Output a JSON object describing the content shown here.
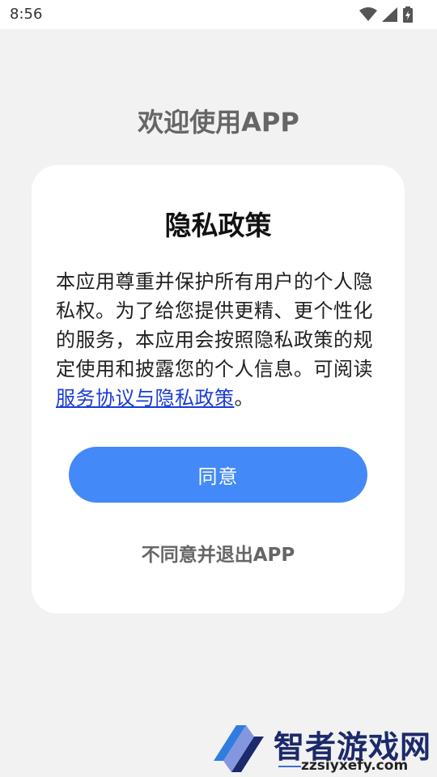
{
  "status_bar": {
    "time": "8:56",
    "icons": [
      "wifi-icon",
      "cellular-signal-icon",
      "battery-charging-icon"
    ]
  },
  "welcome_title": "欢迎使用APP",
  "dialog": {
    "title": "隐私政策",
    "body_text": "本应用尊重并保护所有用户的个人隐私权。为了给您提供更精、更个性化的服务，本应用会按照隐私政策的规定使用和披露您的个人信息。可阅读",
    "link_text": "服务协议与隐私政策",
    "body_end": "。",
    "agree_label": "同意",
    "disagree_label": "不同意并退出APP"
  },
  "watermark": {
    "name": "智者游戏网",
    "url": "zzsiyxefy.com"
  },
  "colors": {
    "background": "#f2f2f2",
    "card": "#ffffff",
    "accent": "#4389f7",
    "link": "#1a3bd6"
  }
}
